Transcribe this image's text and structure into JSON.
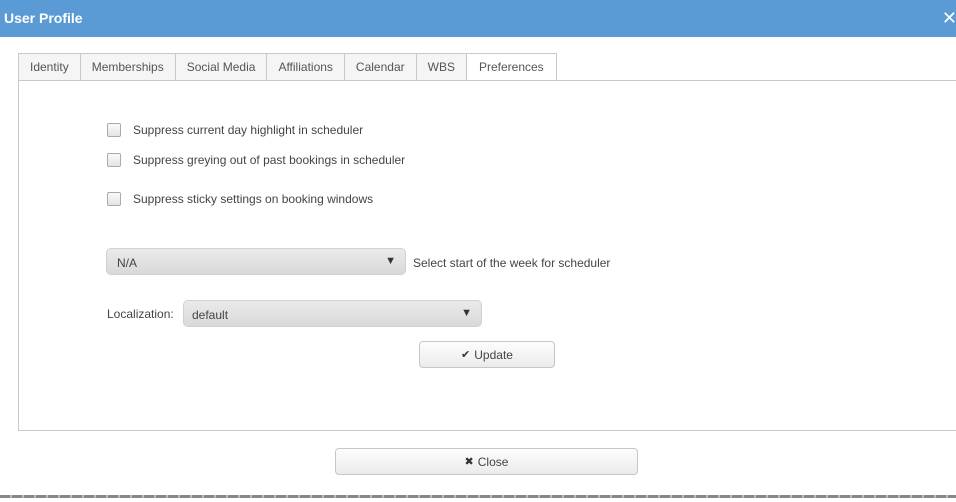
{
  "window": {
    "title": "User Profile",
    "close_glyph": "✕"
  },
  "tabs": [
    {
      "label": "Identity"
    },
    {
      "label": "Memberships"
    },
    {
      "label": "Social Media"
    },
    {
      "label": "Affiliations"
    },
    {
      "label": "Calendar"
    },
    {
      "label": "WBS"
    },
    {
      "label": "Preferences",
      "active": true
    }
  ],
  "preferences": {
    "checkboxes": [
      {
        "label": "Suppress current day highlight in scheduler",
        "checked": false
      },
      {
        "label": "Suppress greying out of past bookings in scheduler",
        "checked": false
      },
      {
        "label": "Suppress sticky settings on booking windows",
        "checked": false
      }
    ],
    "week_start": {
      "value": "N/A",
      "caption": "Select start of the week for scheduler"
    },
    "localization": {
      "label": "Localization:",
      "value": "default"
    },
    "update_label": "Update"
  },
  "footer": {
    "close_label": "Close"
  },
  "icons": {
    "dropdown": "caret-down-icon",
    "update": "check-icon",
    "close": "close-x-icon"
  }
}
